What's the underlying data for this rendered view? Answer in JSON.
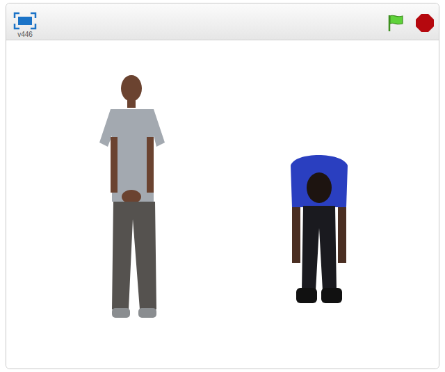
{
  "toolbar": {
    "version_label": "v446"
  }
}
